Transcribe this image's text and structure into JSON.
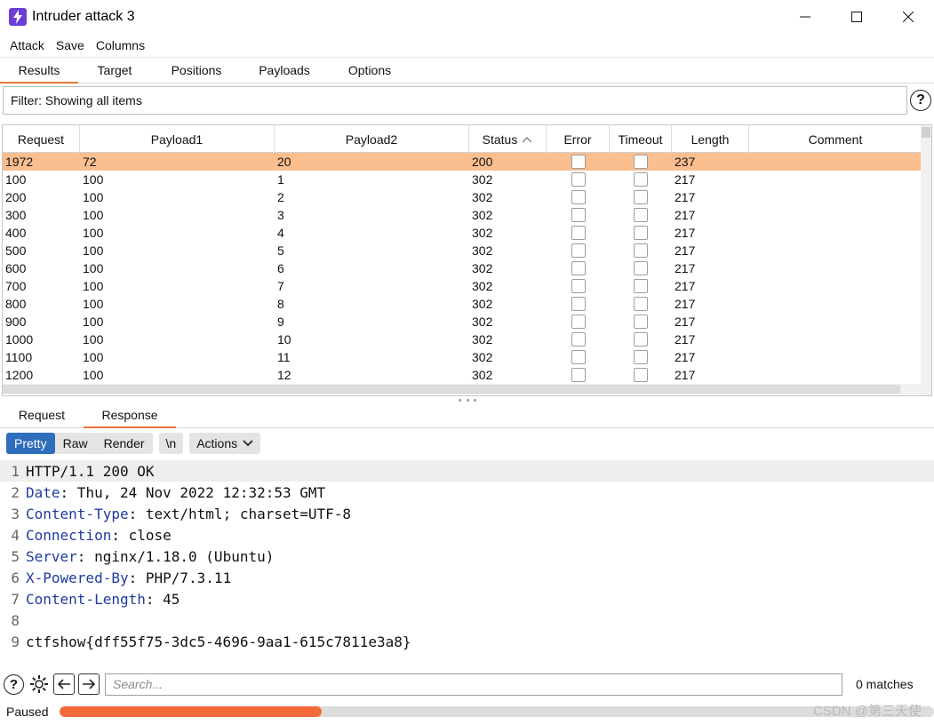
{
  "window": {
    "title": "Intruder attack 3",
    "app_icon": "lightning-icon",
    "accent_color": "#6b3fd6"
  },
  "menu": [
    "Attack",
    "Save",
    "Columns"
  ],
  "top_tabs": [
    {
      "label": "Results",
      "active": true
    },
    {
      "label": "Target",
      "active": false
    },
    {
      "label": "Positions",
      "active": false
    },
    {
      "label": "Payloads",
      "active": false
    },
    {
      "label": "Options",
      "active": false
    }
  ],
  "filter": {
    "text": "Filter: Showing all items"
  },
  "table": {
    "columns": [
      "Request",
      "Payload1",
      "Payload2",
      "Status",
      "Error",
      "Timeout",
      "Length",
      "Comment"
    ],
    "sort_column": "Status",
    "sort_indicator": "^",
    "selected_color": "#fbbe8f",
    "rows": [
      {
        "request": "1972",
        "payload1": "72",
        "payload2": "20",
        "status": "200",
        "error": false,
        "timeout": false,
        "length": "237",
        "comment": "",
        "selected": true
      },
      {
        "request": "100",
        "payload1": "100",
        "payload2": "1",
        "status": "302",
        "error": false,
        "timeout": false,
        "length": "217",
        "comment": "",
        "selected": false
      },
      {
        "request": "200",
        "payload1": "100",
        "payload2": "2",
        "status": "302",
        "error": false,
        "timeout": false,
        "length": "217",
        "comment": "",
        "selected": false
      },
      {
        "request": "300",
        "payload1": "100",
        "payload2": "3",
        "status": "302",
        "error": false,
        "timeout": false,
        "length": "217",
        "comment": "",
        "selected": false
      },
      {
        "request": "400",
        "payload1": "100",
        "payload2": "4",
        "status": "302",
        "error": false,
        "timeout": false,
        "length": "217",
        "comment": "",
        "selected": false
      },
      {
        "request": "500",
        "payload1": "100",
        "payload2": "5",
        "status": "302",
        "error": false,
        "timeout": false,
        "length": "217",
        "comment": "",
        "selected": false
      },
      {
        "request": "600",
        "payload1": "100",
        "payload2": "6",
        "status": "302",
        "error": false,
        "timeout": false,
        "length": "217",
        "comment": "",
        "selected": false
      },
      {
        "request": "700",
        "payload1": "100",
        "payload2": "7",
        "status": "302",
        "error": false,
        "timeout": false,
        "length": "217",
        "comment": "",
        "selected": false
      },
      {
        "request": "800",
        "payload1": "100",
        "payload2": "8",
        "status": "302",
        "error": false,
        "timeout": false,
        "length": "217",
        "comment": "",
        "selected": false
      },
      {
        "request": "900",
        "payload1": "100",
        "payload2": "9",
        "status": "302",
        "error": false,
        "timeout": false,
        "length": "217",
        "comment": "",
        "selected": false
      },
      {
        "request": "1000",
        "payload1": "100",
        "payload2": "10",
        "status": "302",
        "error": false,
        "timeout": false,
        "length": "217",
        "comment": "",
        "selected": false
      },
      {
        "request": "1100",
        "payload1": "100",
        "payload2": "11",
        "status": "302",
        "error": false,
        "timeout": false,
        "length": "217",
        "comment": "",
        "selected": false
      },
      {
        "request": "1200",
        "payload1": "100",
        "payload2": "12",
        "status": "302",
        "error": false,
        "timeout": false,
        "length": "217",
        "comment": "",
        "selected": false
      }
    ]
  },
  "bottom_tabs": [
    {
      "label": "Request",
      "active": false
    },
    {
      "label": "Response",
      "active": true
    }
  ],
  "view_modes": [
    {
      "label": "Pretty",
      "active": true
    },
    {
      "label": "Raw",
      "active": false
    },
    {
      "label": "Render",
      "active": false
    }
  ],
  "newline_toggle": "\\n",
  "actions_label": "Actions",
  "response_lines": [
    {
      "num": "1",
      "key": "",
      "sep": "",
      "value": "HTTP/1.1 200 OK"
    },
    {
      "num": "2",
      "key": "Date",
      "sep": ":",
      "value": " Thu, 24 Nov 2022 12:32:53 GMT"
    },
    {
      "num": "3",
      "key": "Content-Type",
      "sep": ":",
      "value": " text/html; charset=UTF-8"
    },
    {
      "num": "4",
      "key": "Connection",
      "sep": ":",
      "value": " close"
    },
    {
      "num": "5",
      "key": "Server",
      "sep": ":",
      "value": " nginx/1.18.0 (Ubuntu)"
    },
    {
      "num": "6",
      "key": "X-Powered-By",
      "sep": ":",
      "value": " PHP/7.3.11"
    },
    {
      "num": "7",
      "key": "Content-Length",
      "sep": ":",
      "value": " 45"
    },
    {
      "num": "8",
      "key": "",
      "sep": "",
      "value": ""
    },
    {
      "num": "9",
      "key": "",
      "sep": "",
      "value": "ctfshow{dff55f75-3dc5-4696-9aa1-615c7811e3a8}"
    }
  ],
  "search": {
    "placeholder": "Search...",
    "matches": "0 matches"
  },
  "status": {
    "text": "Paused",
    "progress": 0.3,
    "progress_color": "#f3693a"
  },
  "watermark": "CSDN @第三天使"
}
